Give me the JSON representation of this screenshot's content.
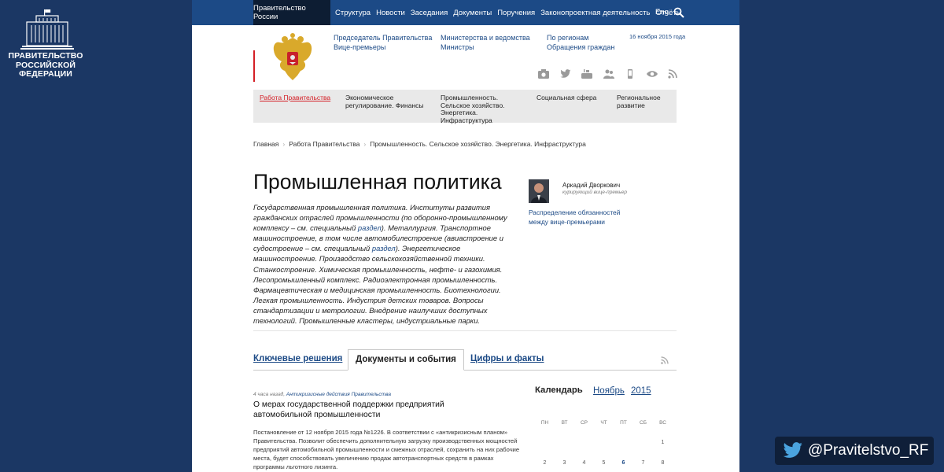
{
  "brand": {
    "lines": [
      "ПРАВИТЕЛЬСТВО",
      "РОССИЙСКОЙ",
      "ФЕДЕРАЦИИ"
    ]
  },
  "twitter": {
    "handle": "@Pravitelstvo_RF"
  },
  "topnav": {
    "home": "Правительство России",
    "links": [
      "Структура",
      "Новости",
      "Заседания",
      "Документы",
      "Поручения",
      "Законопроектная деятельность",
      "Отчёты"
    ],
    "lang": "Eng"
  },
  "header": {
    "col1": [
      "Председатель Правительства",
      "Вице-премьеры"
    ],
    "col2": [
      "Министерства и ведомства",
      "Министры"
    ],
    "col3": [
      "По регионам",
      "Обращения граждан"
    ],
    "date": "16 ноября 2015 года",
    "socials": [
      "camera-icon",
      "twitter-icon",
      "youtube-icon",
      "community-icon",
      "mobile-icon",
      "eye-icon",
      "rss-icon"
    ]
  },
  "sections": [
    "Работа Правительства",
    "Экономическое регулирование. Финансы",
    "Промышленность. Сельское хозяйство. Энергетика. Инфраструктура",
    "Социальная сфера",
    "Региональное развитие"
  ],
  "breadcrumb": [
    "Главная",
    "Работа Правительства",
    "Промышленность. Сельское хозяйство. Энергетика. Инфраструктура"
  ],
  "page": {
    "title": "Промышленная политика",
    "intro_1": "Государственная промышленная политика. Институты развития гражданских отраслей промышленности (по оборонно-промышленному комплексу – см. специальный ",
    "intro_link1": "раздел",
    "intro_2": "). Металлургия. Транспортное машиностроение, в том числе автомобилестроение (авиастроение и судостроение – см. специальный ",
    "intro_link2": "раздел",
    "intro_3": "). Энергетическое машиностроение. Производство сельскохозяйственной техники. Станкостроение. Химическая промышленность, нефте- и газохимия. Лесопромышленный комплекс. Радиоэлектронная промышленность. Фармацевтическая и медицинская промышленность. Биотехнологии. Легкая промышленность. Индустрия детских товаров. Вопросы стандартизации и метрологии. Внедрение наилучших доступных технологий. Промышленные кластеры, индустриальные парки."
  },
  "person": {
    "name": "Аркадий Дворкович",
    "role": "курирующий вице-премьер",
    "resp_line1": "Распределение обязанностей",
    "resp_line2": "между вице-премьерами"
  },
  "tabs": [
    "Ключевые решения",
    "Документы и события",
    "Цифры и факты"
  ],
  "news": {
    "time": "4 часа назад,",
    "category": "Антикризисные действия Правительства",
    "title": "О мерах государственной поддержки предприятий автомобильной промышленности",
    "text": "Постановление от 12 ноября 2015 года №1226. В соответствии с «антикризисным планом» Правительства. Позволит обеспечить дополнительную загрузку производственных мощностей предприятий автомобильной промышленности и смежных отраслей, сохранить на них рабочие места, будет способствовать увеличению продаж автотранспортных средств в рамках программы льготного лизинга."
  },
  "calendar": {
    "label": "Календарь",
    "month": "Ноябрь",
    "year": "2015",
    "dow": [
      "ПН",
      "ВТ",
      "СР",
      "ЧТ",
      "ПТ",
      "СБ",
      "ВС"
    ],
    "week1": [
      "",
      "",
      "",
      "",
      "",
      "",
      "1"
    ],
    "week2": [
      "2",
      "3",
      "4",
      "5",
      "6",
      "7",
      "8"
    ]
  }
}
